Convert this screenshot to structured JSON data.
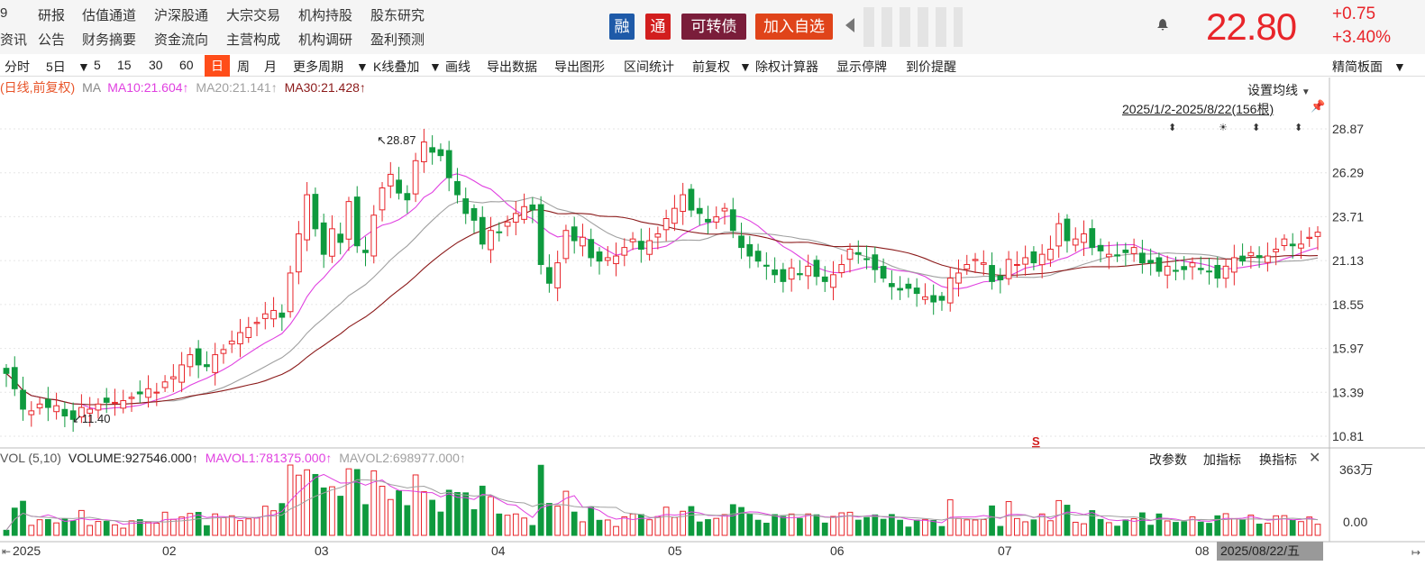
{
  "nav": {
    "row1": [
      "9",
      "研报",
      "估值通道",
      "沪深股通",
      "大宗交易",
      "机构持股",
      "股东研究"
    ],
    "row2": [
      "资讯",
      "公告",
      "财务摘要",
      "资金流向",
      "主营构成",
      "机构调研",
      "盈利预测"
    ],
    "tags": [
      "融",
      "通",
      "可转债",
      "加入自选"
    ],
    "price": "22.80",
    "change": "+0.75",
    "change_pct": "+3.40%"
  },
  "toolbar": {
    "items": [
      "分时",
      "5日",
      "5",
      "15",
      "30",
      "60",
      "日",
      "周",
      "月",
      "更多周期",
      "K线叠加",
      "画线",
      "导出数据",
      "导出图形",
      "区间统计",
      "前复权",
      "除权计算器",
      "显示停牌",
      "到价提醒"
    ],
    "right": "精简板面"
  },
  "legend": {
    "mode": "(日线,前复权)",
    "ma": "MA",
    "ma10": "MA10:21.604↑",
    "ma20": "MA20:21.141↑",
    "ma30": "MA30:21.428↑"
  },
  "setting": "设置均线",
  "range": "2025/1/2-2025/8/22(156根)",
  "vol_legend": {
    "name": "VOL (5,10)",
    "volume": "VOLUME:927546.000↑",
    "mavol1": "MAVOL1:781375.000↑",
    "mavol2": "MAVOL2:698977.000↑"
  },
  "vol_buttons": [
    "改参数",
    "加指标",
    "换指标"
  ],
  "marks": {
    "high": "28.87",
    "low": "11.40",
    "s": "S"
  },
  "colors": {
    "up": "#e8252a",
    "down": "#0e9a3e",
    "ma10": "#e040e0",
    "ma20": "#a0a0a0",
    "ma30": "#8b1a1a",
    "accent": "#ff4d1a"
  },
  "chart_data": {
    "type": "candlestick",
    "ylim": [
      10.81,
      28.87
    ],
    "y_ticks": [
      "28.87",
      "26.29",
      "23.71",
      "21.13",
      "18.55",
      "15.97",
      "13.39",
      "10.81"
    ],
    "vol_ticks": [
      "363万",
      "0.00"
    ],
    "x_ticks": [
      "2025",
      "02",
      "03",
      "04",
      "05",
      "06",
      "07",
      "08",
      "2025/08/22/五"
    ],
    "close_approx": [
      14.5,
      13.6,
      12.4,
      12.3,
      12.7,
      12.5,
      12.6,
      12.0,
      11.8,
      12.5,
      12.4,
      12.7,
      12.8,
      12.8,
      12.9,
      13.1,
      13.3,
      13.6,
      13.4,
      14.0,
      14.3,
      15.0,
      15.6,
      15.0,
      14.9,
      15.6,
      15.9,
      16.4,
      16.9,
      17.2,
      17.5,
      18.0,
      18.2,
      17.8,
      20.4,
      22.7,
      25.0,
      23.0,
      21.5,
      23.0,
      22.2,
      24.6,
      22.0,
      21.6,
      23.8,
      25.4,
      26.2,
      25.1,
      24.7,
      27.0,
      28.1,
      27.5,
      27.3,
      26.0,
      25.0,
      23.9,
      23.5,
      22.1,
      22.9,
      22.8,
      23.4,
      23.9,
      24.3,
      24.1,
      20.9,
      19.8,
      21.0,
      22.9,
      22.3,
      22.5,
      21.3,
      21.1,
      21.3,
      21.4,
      21.9,
      22.4,
      21.8,
      22.3,
      22.7,
      23.6,
      24.2,
      25.0,
      24.1,
      23.9,
      23.4,
      23.7,
      24.2,
      22.9,
      21.9,
      21.4,
      21.1,
      20.8,
      20.3,
      19.9,
      20.7,
      20.3,
      20.8,
      20.2,
      19.9,
      20.3,
      20.9,
      21.8,
      21.5,
      21.2,
      20.6,
      20.1,
      19.6,
      19.4,
      19.5,
      19.2,
      19.0,
      18.7,
      18.8,
      20.1,
      20.4,
      20.9,
      21.2,
      21.0,
      19.9,
      20.0,
      21.2,
      20.9,
      21.3,
      21.0,
      21.5,
      21.8,
      23.3,
      22.3,
      22.4,
      22.7,
      21.9,
      21.7,
      21.5,
      21.4,
      21.6,
      21.9,
      21.0,
      21.0,
      20.5,
      20.8,
      20.5,
      20.6,
      21.0,
      20.6,
      20.5,
      20.1,
      20.8,
      21.3,
      21.1,
      21.6,
      21.3,
      21.4,
      21.8,
      22.4,
      22.0,
      22.1,
      22.5,
      22.8
    ]
  }
}
